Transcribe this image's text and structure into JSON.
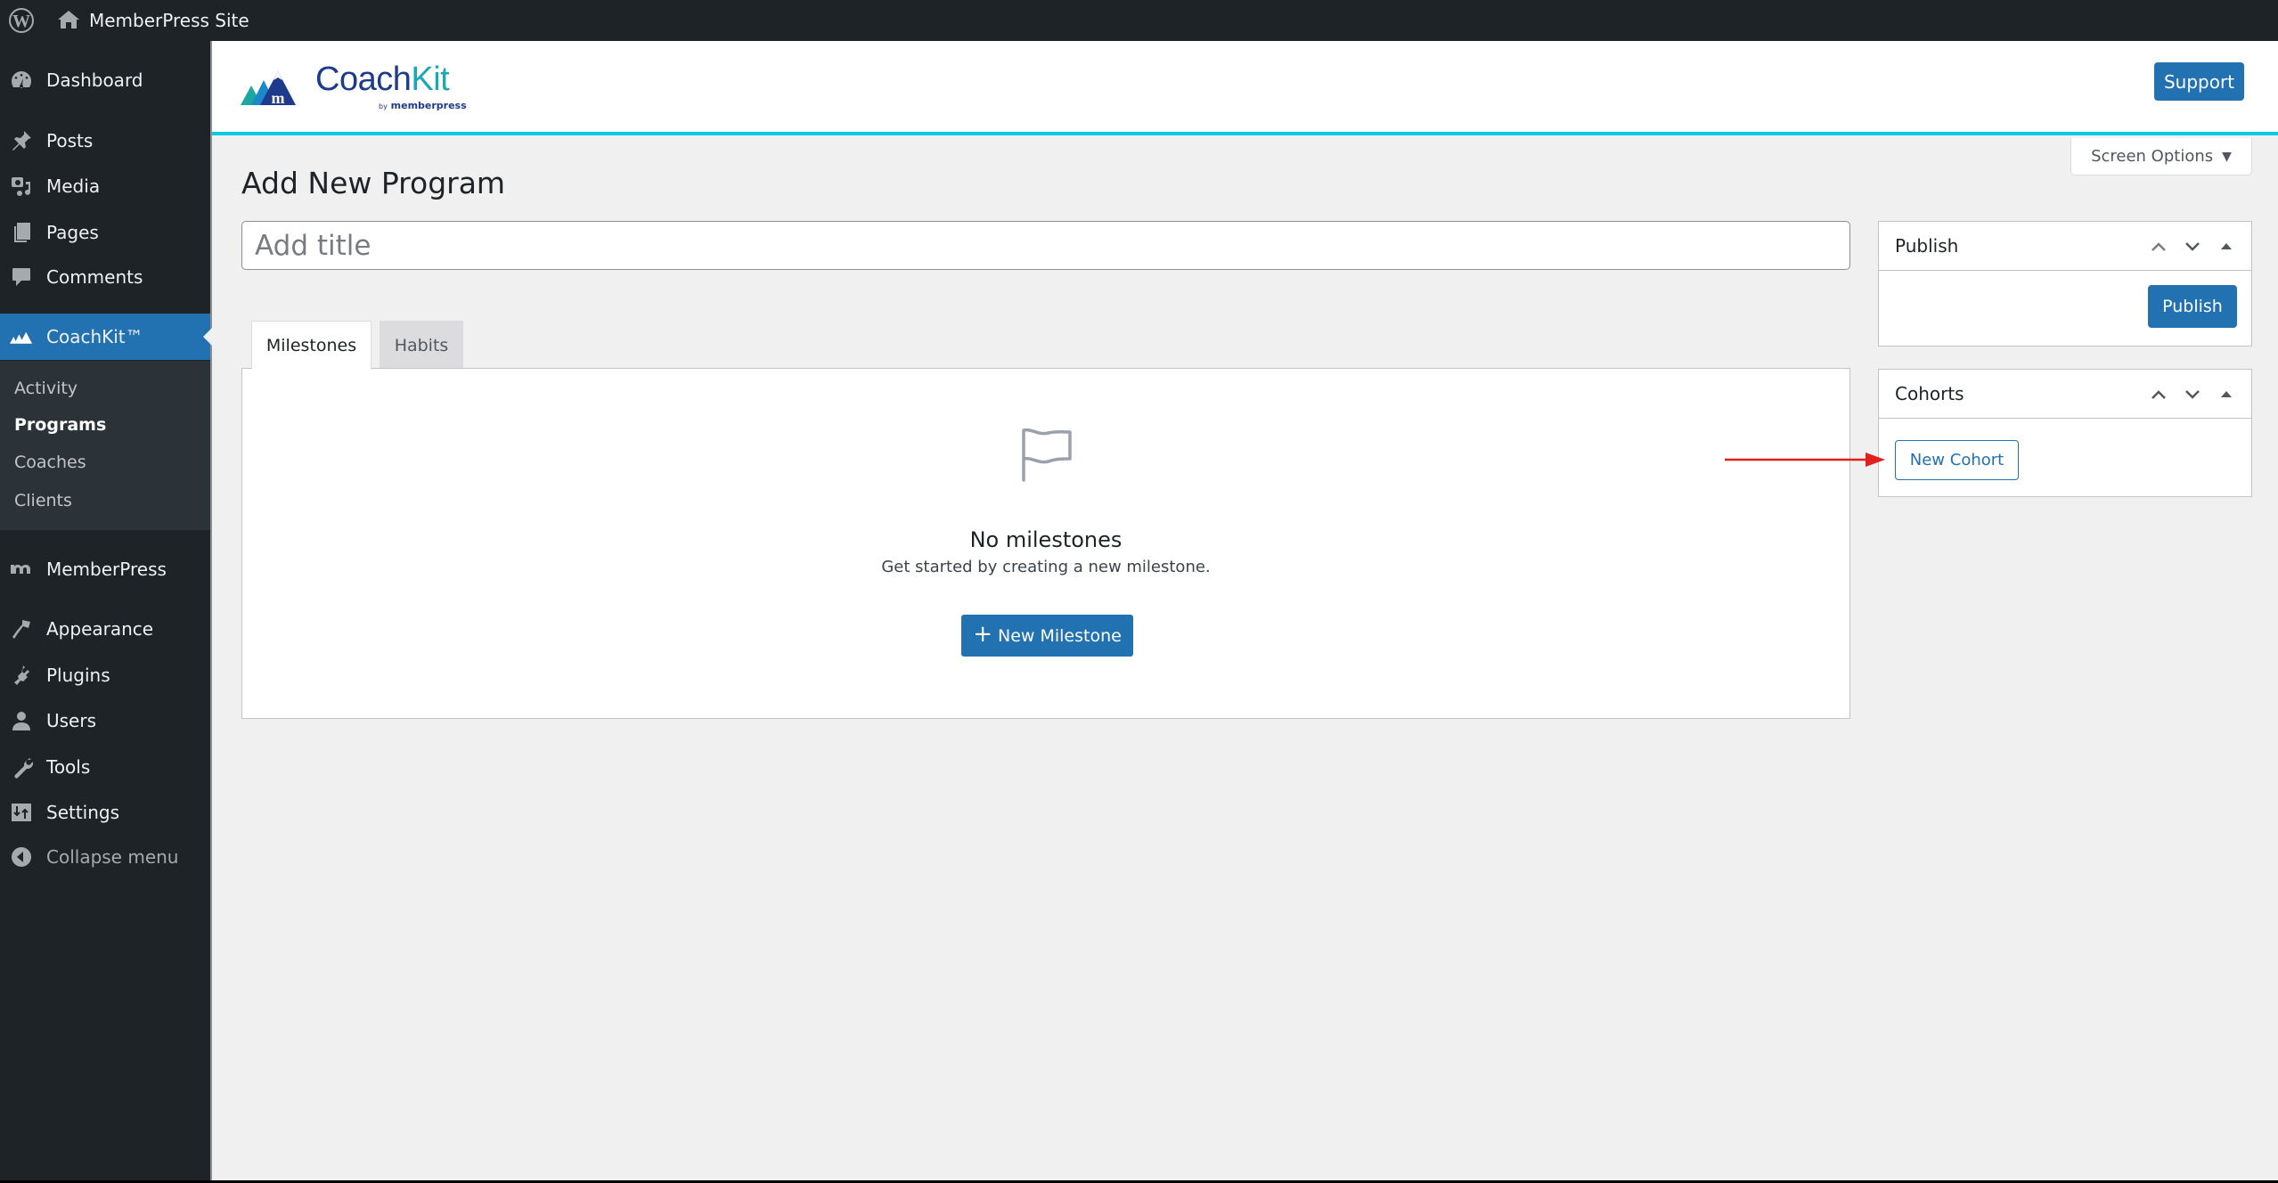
{
  "admin_bar": {
    "site_name": "MemberPress Site",
    "wp_logo_icon": "wordpress-logo-icon",
    "home_icon": "home-icon"
  },
  "sidebar": {
    "items": [
      {
        "label": "Dashboard",
        "icon": "dashboard-icon"
      },
      {
        "label": "Posts",
        "icon": "pin-icon"
      },
      {
        "label": "Media",
        "icon": "media-icon"
      },
      {
        "label": "Pages",
        "icon": "pages-icon"
      },
      {
        "label": "Comments",
        "icon": "comment-icon"
      },
      {
        "label": "CoachKit™",
        "icon": "mountains-icon",
        "current": true
      },
      {
        "label": "MemberPress",
        "icon": "memberpress-icon"
      },
      {
        "label": "Appearance",
        "icon": "paintbrush-icon"
      },
      {
        "label": "Plugins",
        "icon": "plugin-icon"
      },
      {
        "label": "Users",
        "icon": "user-icon"
      },
      {
        "label": "Tools",
        "icon": "wrench-icon"
      },
      {
        "label": "Settings",
        "icon": "settings-icon"
      },
      {
        "label": "Collapse menu",
        "icon": "collapse-icon"
      }
    ],
    "submenu": [
      {
        "label": "Activity",
        "active": false
      },
      {
        "label": "Programs",
        "active": true
      },
      {
        "label": "Coaches",
        "active": false
      },
      {
        "label": "Clients",
        "active": false
      }
    ]
  },
  "header": {
    "logo_name": "Coach",
    "logo_name_accent": "Kit",
    "logo_by": "by",
    "logo_brand": "memberpress",
    "support_label": "Support",
    "accent_color": "#06cbe0",
    "primary_color": "#2271b1"
  },
  "screen_options": {
    "label": "Screen Options"
  },
  "main": {
    "page_title": "Add New Program",
    "title_input": {
      "value": "",
      "placeholder": "Add title"
    },
    "tabs": [
      {
        "label": "Milestones",
        "active": true
      },
      {
        "label": "Habits",
        "active": false
      }
    ],
    "empty_state": {
      "title": "No milestones",
      "subtitle": "Get started by creating a new milestone.",
      "button_label": "New Milestone",
      "icon": "flag-icon"
    }
  },
  "metaboxes": {
    "publish": {
      "title": "Publish",
      "button_label": "Publish"
    },
    "cohorts": {
      "title": "Cohorts",
      "button_label": "New Cohort"
    }
  },
  "annotation": {
    "arrow_color": "#e0201c",
    "points_to": "New Cohort"
  }
}
